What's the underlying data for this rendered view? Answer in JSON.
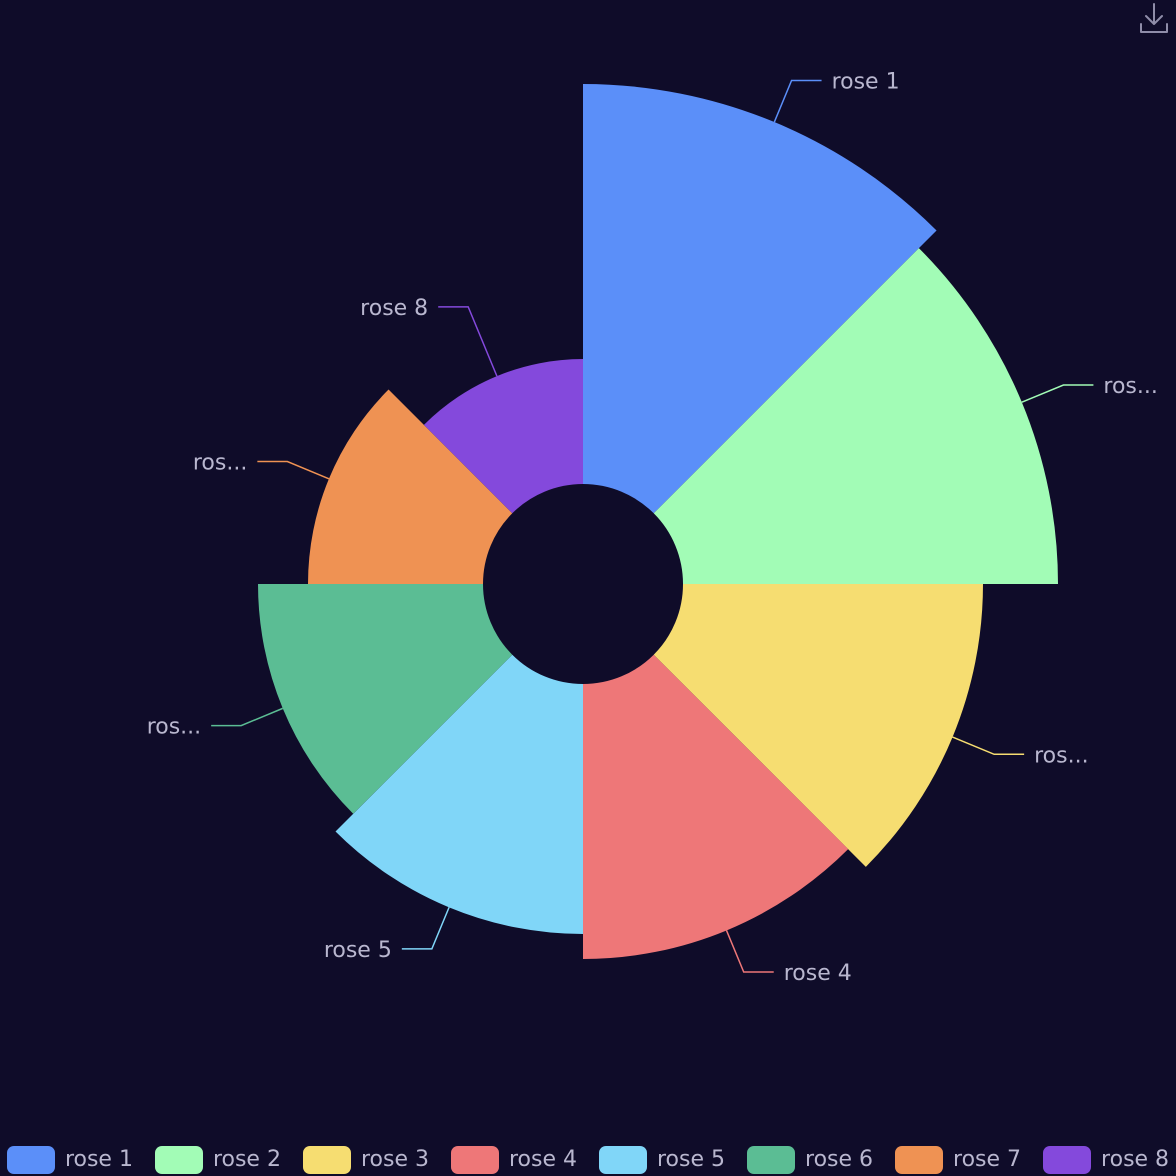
{
  "chart_data": {
    "type": "pie",
    "subtype": "nightingale-rose",
    "categories": [
      "rose 1",
      "rose 2",
      "rose 3",
      "rose 4",
      "rose 5",
      "rose 6",
      "rose 7",
      "rose 8"
    ],
    "values": [
      40,
      38,
      32,
      30,
      28,
      26,
      22,
      18
    ],
    "outer_labels": [
      "rose 1",
      "ros...",
      "ros...",
      "rose 4",
      "rose 5",
      "ros...",
      "ros...",
      "rose 8"
    ],
    "colors": [
      "#5b8ff9",
      "#a2fcb6",
      "#f6dd71",
      "#ee7778",
      "#80d6f8",
      "#5bbd94",
      "#ef9253",
      "#8449dc"
    ],
    "legend_position": "bottom"
  },
  "toolbar": {
    "download_icon": "download-icon"
  }
}
